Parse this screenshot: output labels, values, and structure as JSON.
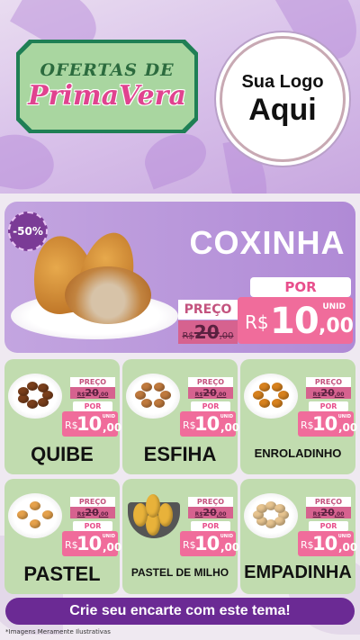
{
  "header": {
    "title_line1": "OFERTAS DE",
    "title_line2": "PrimaVera",
    "logo_line1": "Sua Logo",
    "logo_line2": "Aqui"
  },
  "hero": {
    "discount_badge": "-50%",
    "product": "COXINHA",
    "preco_label": "PREÇO",
    "old_currency": "R$",
    "old_price": "20",
    "old_cents": ",00",
    "por_label": "POR",
    "unid_label": "UNID",
    "new_currency": "R$",
    "new_price": "10",
    "new_cents": ",00"
  },
  "products": [
    {
      "name": "QUIBE",
      "preco_label": "PREÇO",
      "old_currency": "R$",
      "old_price": "20",
      "old_cents": ",00",
      "por_label": "POR",
      "unid_label": "UNID",
      "new_currency": "R$",
      "new_price": "10",
      "new_cents": ",00"
    },
    {
      "name": "ESFIHA",
      "preco_label": "PREÇO",
      "old_currency": "R$",
      "old_price": "20",
      "old_cents": ",00",
      "por_label": "POR",
      "unid_label": "UNID",
      "new_currency": "R$",
      "new_price": "10",
      "new_cents": ",00"
    },
    {
      "name": "ENROLADINHO",
      "preco_label": "PREÇO",
      "old_currency": "R$",
      "old_price": "20",
      "old_cents": ",00",
      "por_label": "POR",
      "unid_label": "UNID",
      "new_currency": "R$",
      "new_price": "10",
      "new_cents": ",00"
    },
    {
      "name": "PASTEL",
      "preco_label": "PREÇO",
      "old_currency": "R$",
      "old_price": "20",
      "old_cents": ",00",
      "por_label": "POR",
      "unid_label": "UNID",
      "new_currency": "R$",
      "new_price": "10",
      "new_cents": ",00"
    },
    {
      "name": "PASTEL DE MILHO",
      "preco_label": "PREÇO",
      "old_currency": "R$",
      "old_price": "20",
      "old_cents": ",00",
      "por_label": "POR",
      "unid_label": "UNID",
      "new_currency": "R$",
      "new_price": "10",
      "new_cents": ",00"
    },
    {
      "name": "EMPADINHA",
      "preco_label": "PREÇO",
      "old_currency": "R$",
      "old_price": "20",
      "old_cents": ",00",
      "por_label": "POR",
      "unid_label": "UNID",
      "new_currency": "R$",
      "new_price": "10",
      "new_cents": ",00"
    }
  ],
  "footer": {
    "cta": "Crie seu encarte com este tema!",
    "note": "*Imagens Meramente Ilustrativas"
  },
  "colors": {
    "card_green": "#c1dcaf",
    "hero_purple": "#b08ad6",
    "price_pink": "#f06c9b",
    "cta_purple": "#6b2a94",
    "title_pink": "#e0438f"
  }
}
